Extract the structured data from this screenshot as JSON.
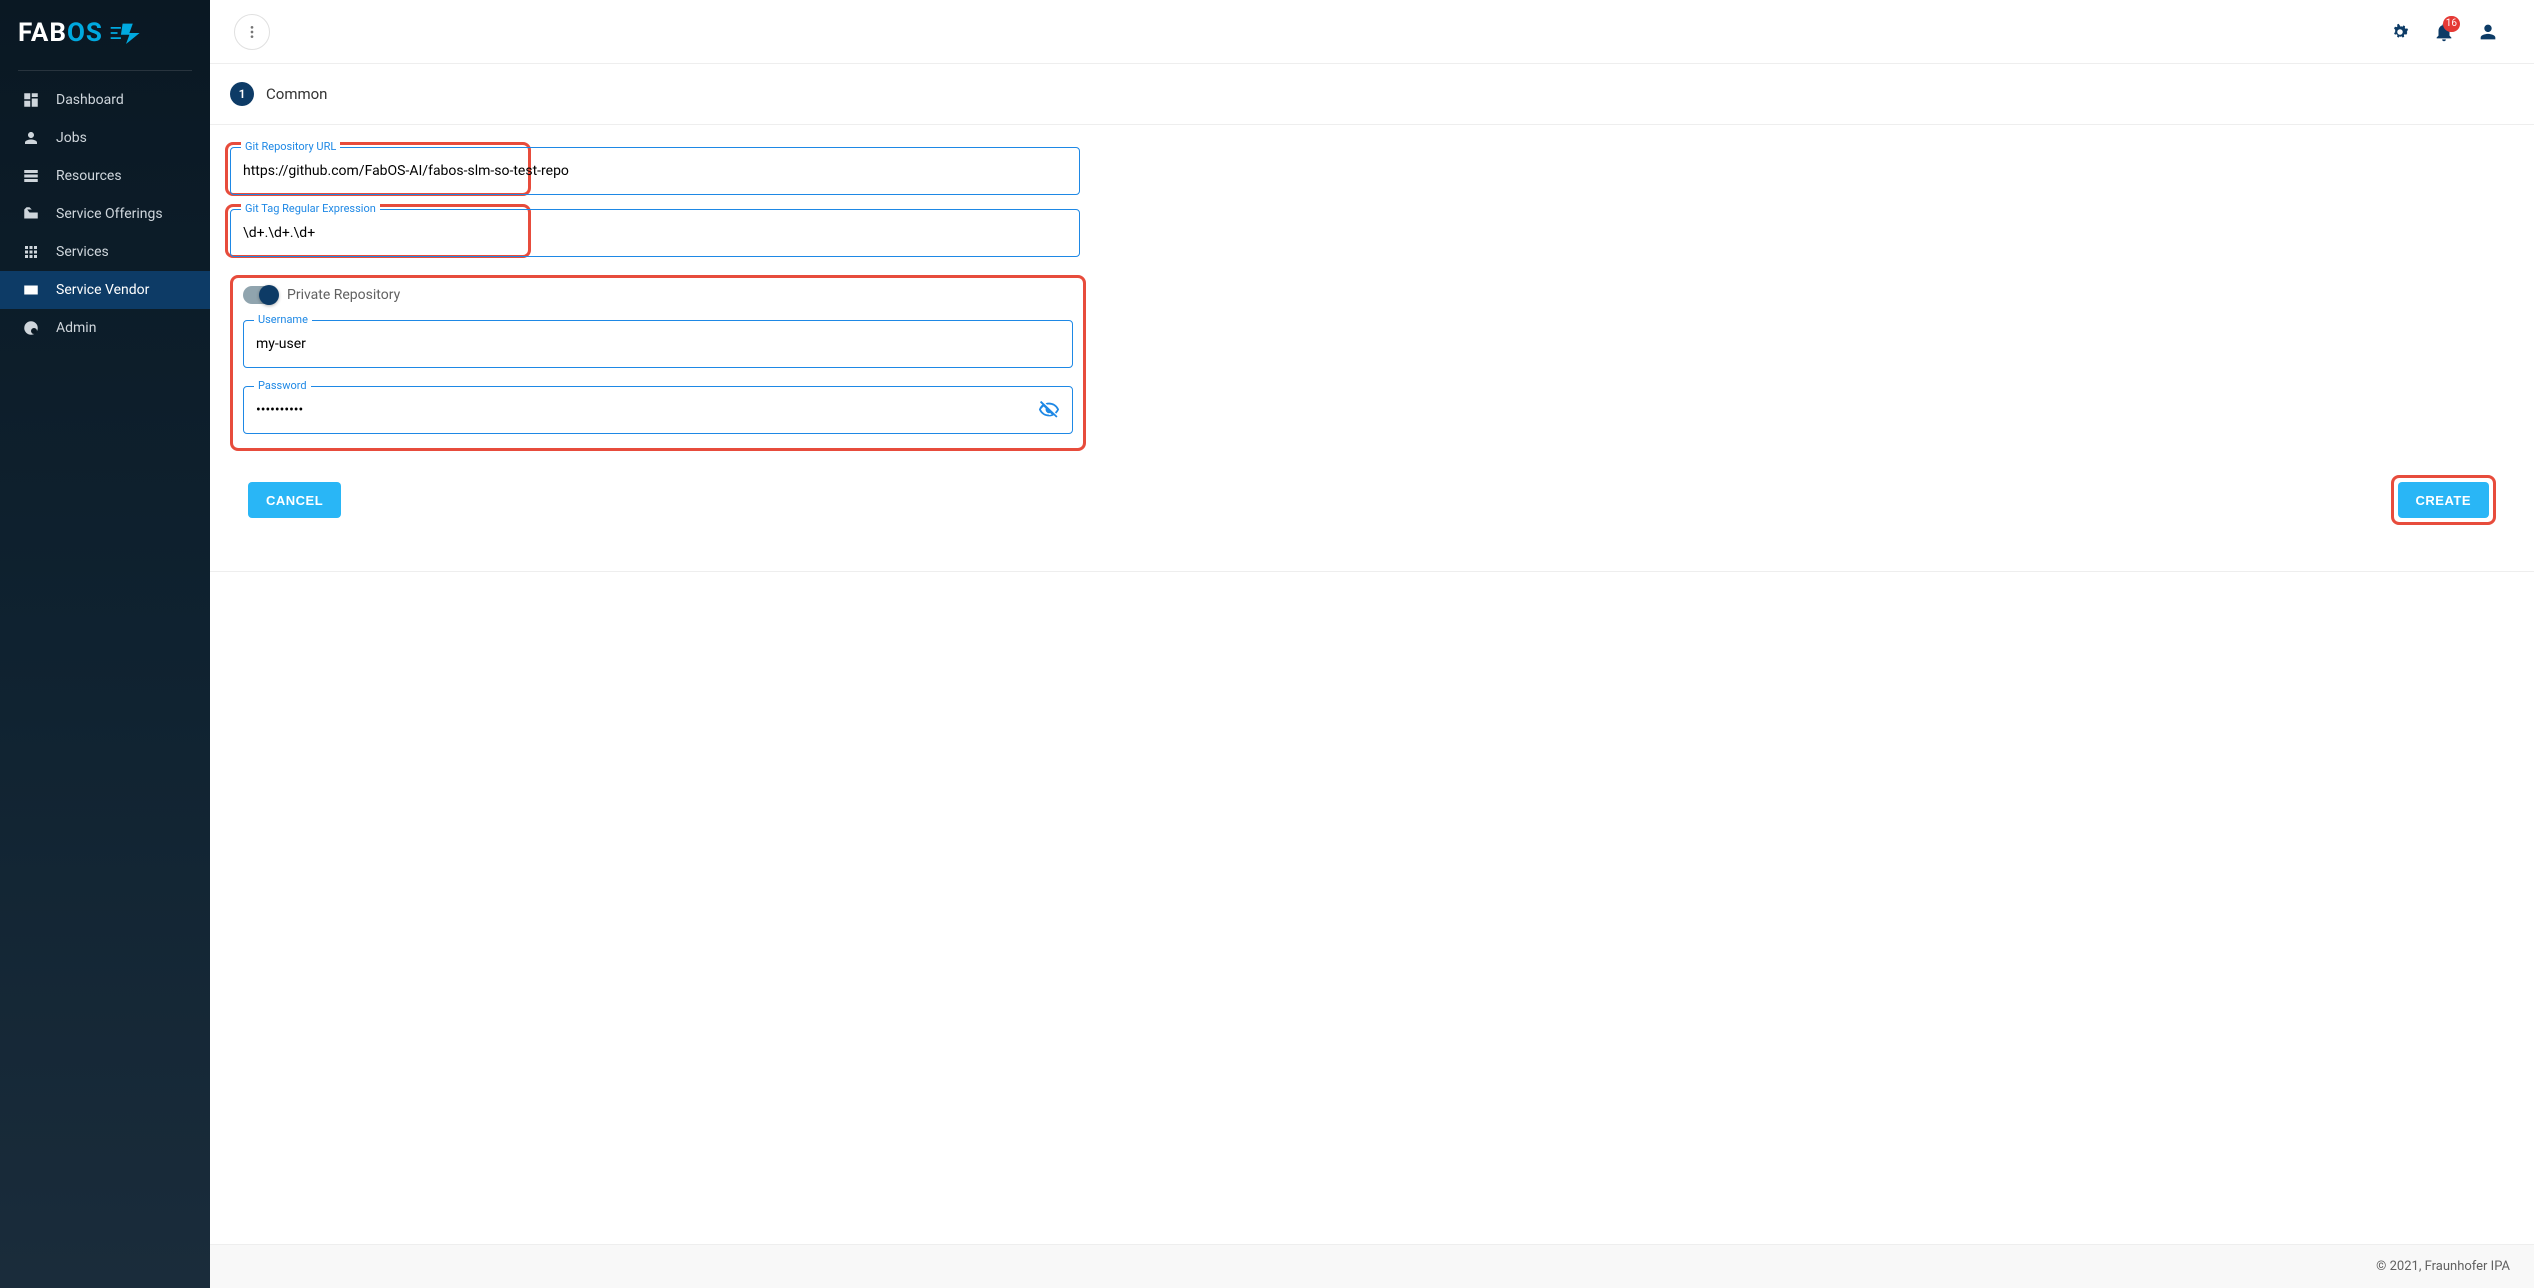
{
  "brand": {
    "part1": "FAB",
    "part2": "OS"
  },
  "sidebar": {
    "items": [
      {
        "label": "Dashboard"
      },
      {
        "label": "Jobs"
      },
      {
        "label": "Resources"
      },
      {
        "label": "Service Offerings"
      },
      {
        "label": "Services"
      },
      {
        "label": "Service Vendor"
      },
      {
        "label": "Admin"
      }
    ]
  },
  "topbar": {
    "notification_count": "16"
  },
  "step": {
    "number": "1",
    "title": "Common"
  },
  "form": {
    "git_url": {
      "label": "Git Repository URL",
      "value": "https://github.com/FabOS-AI/fabos-slm-so-test-repo"
    },
    "git_tag": {
      "label": "Git Tag Regular Expression",
      "value": "\\d+.\\d+.\\d+"
    },
    "private_label": "Private Repository",
    "username": {
      "label": "Username",
      "value": "my-user"
    },
    "password": {
      "label": "Password",
      "value": "••••••••••"
    }
  },
  "actions": {
    "cancel": "Cancel",
    "create": "Create"
  },
  "footer": "© 2021, Fraunhofer IPA"
}
